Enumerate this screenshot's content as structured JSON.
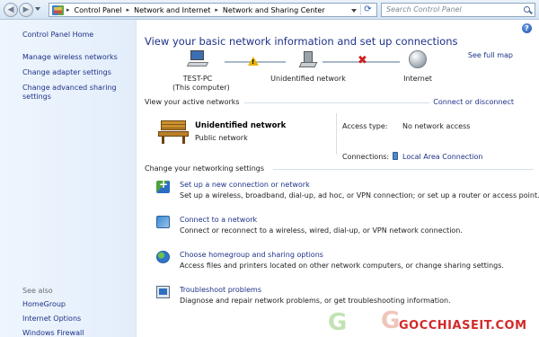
{
  "address_bar": {
    "breadcrumbs": [
      "Control Panel",
      "Network and Internet",
      "Network and Sharing Center"
    ],
    "search_placeholder": "Search Control Panel"
  },
  "left_pane": {
    "home": "Control Panel Home",
    "links": [
      "Manage wireless networks",
      "Change adapter settings",
      "Change advanced sharing",
      "settings"
    ],
    "see_also_label": "See also",
    "see_also": [
      "HomeGroup",
      "Internet Options",
      "Windows Firewall"
    ]
  },
  "main": {
    "help_label": "?",
    "title": "View your basic network information and set up connections",
    "see_full_map": "See full map",
    "map": {
      "computer_name": "TEST-PC",
      "computer_sub": "(This computer)",
      "middle": "Unidentified network",
      "internet": "Internet",
      "warning_glyph": "!",
      "error_glyph": "✖"
    },
    "active_header": "View your active networks",
    "connect_disconnect": "Connect or disconnect",
    "active_network": {
      "name": "Unidentified network",
      "type": "Public network",
      "access_type_label": "Access type:",
      "access_type_value": "No network access",
      "connections_label": "Connections:",
      "connections_value": "Local Area Connection"
    },
    "change_header": "Change your networking settings",
    "tasks": [
      {
        "link": "Set up a new connection or network",
        "desc": "Set up a wireless, broadband, dial-up, ad hoc, or VPN connection; or set up a router or access point.",
        "icon": "new-connection-icon"
      },
      {
        "link": "Connect to a network",
        "desc": "Connect or reconnect to a wireless, wired, dial-up, or VPN network connection.",
        "icon": "connect-network-icon"
      },
      {
        "link": "Choose homegroup and sharing options",
        "desc": "Access files and printers located on other network computers, or change sharing settings.",
        "icon": "homegroup-icon"
      },
      {
        "link": "Troubleshoot problems",
        "desc": "Diagnose and repair network problems, or get troubleshooting information.",
        "icon": "troubleshoot-icon"
      }
    ]
  },
  "watermark": {
    "glyph_1": "G",
    "glyph_2": "G",
    "text": "GOCCHIASEIT.COM"
  }
}
